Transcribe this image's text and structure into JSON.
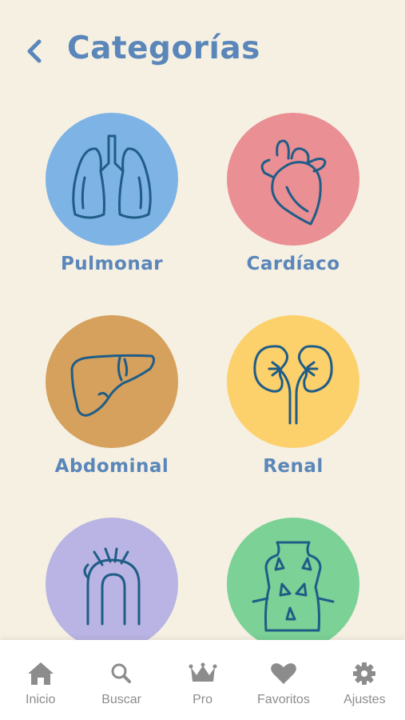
{
  "header": {
    "title": "Categorías"
  },
  "categories": [
    {
      "label": "Pulmonar",
      "color": "#7eb3e5",
      "icon": "lungs-icon"
    },
    {
      "label": "Cardíaco",
      "color": "#ea8f93",
      "icon": "heart-icon"
    },
    {
      "label": "Abdominal",
      "color": "#d6a05d",
      "icon": "liver-icon"
    },
    {
      "label": "Renal",
      "color": "#fcd06b",
      "icon": "kidneys-icon"
    },
    {
      "label": "",
      "color": "#b9b4e3",
      "icon": "aorta-icon"
    },
    {
      "label": "",
      "color": "#7bd196",
      "icon": "torso-icon"
    }
  ],
  "tabbar": {
    "tabs": [
      {
        "label": "Inicio",
        "icon": "home-icon"
      },
      {
        "label": "Buscar",
        "icon": "search-icon"
      },
      {
        "label": "Pro",
        "icon": "crown-icon"
      },
      {
        "label": "Favoritos",
        "icon": "heart-icon"
      },
      {
        "label": "Ajustes",
        "icon": "gear-icon"
      }
    ]
  },
  "colors": {
    "background": "#f5f0e2",
    "accent": "#5a86ba",
    "icon_stroke": "#1f5d87",
    "tab_inactive": "#8c8c8c"
  }
}
